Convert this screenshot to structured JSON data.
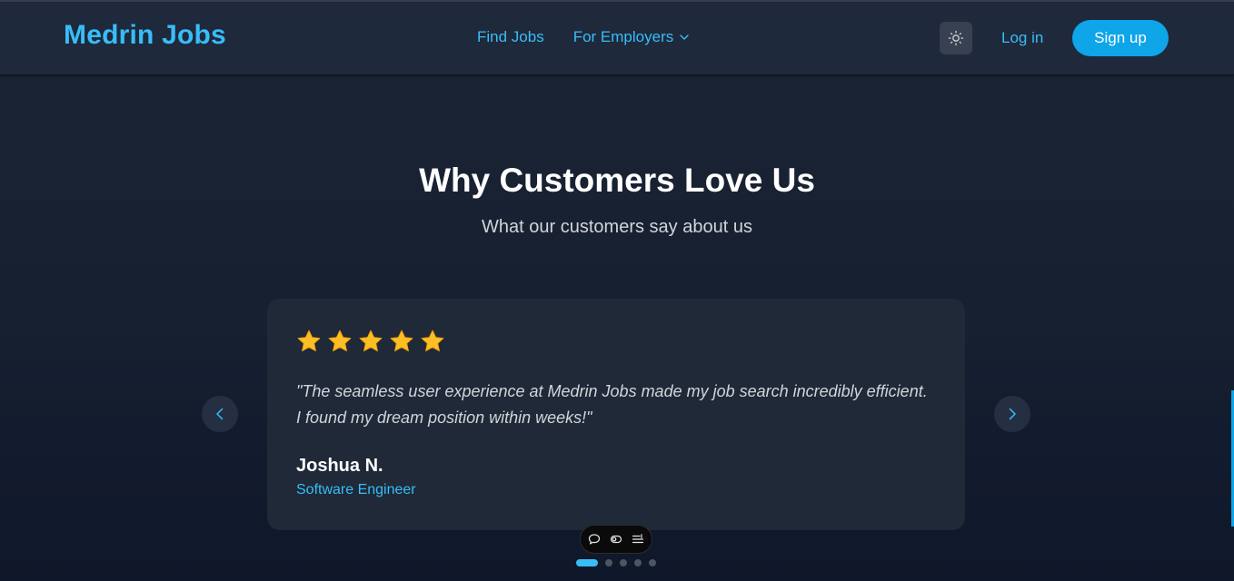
{
  "brand": {
    "name": "Medrin Jobs",
    "color": "#38bdf8"
  },
  "nav": {
    "find_jobs": "Find Jobs",
    "for_employers": "For Employers"
  },
  "header_actions": {
    "theme_icon": "sun-icon",
    "login": "Log in",
    "signup": "Sign up"
  },
  "section": {
    "title": "Why Customers Love Us",
    "subtitle": "What our customers say about us"
  },
  "testimonial": {
    "rating": 5,
    "rating_max": 5,
    "quote": "\"The seamless user experience at Medrin Jobs made my job search incredibly efficient. I found my dream position within weeks!\"",
    "author": "Joshua N.",
    "role": "Software Engineer"
  },
  "carousel": {
    "prev_icon": "chevron-left-icon",
    "next_icon": "chevron-right-icon",
    "slide_count": 5,
    "active_index": 0
  },
  "floating_toolbar": {
    "icons": [
      "comment-icon",
      "toggle-icon",
      "list-settings-icon"
    ]
  },
  "colors": {
    "accent": "#38bdf8",
    "button": "#0ea5e9",
    "header_bg": "#1e293b",
    "card_bg": "#1f2937",
    "star": "#fbbf24"
  }
}
